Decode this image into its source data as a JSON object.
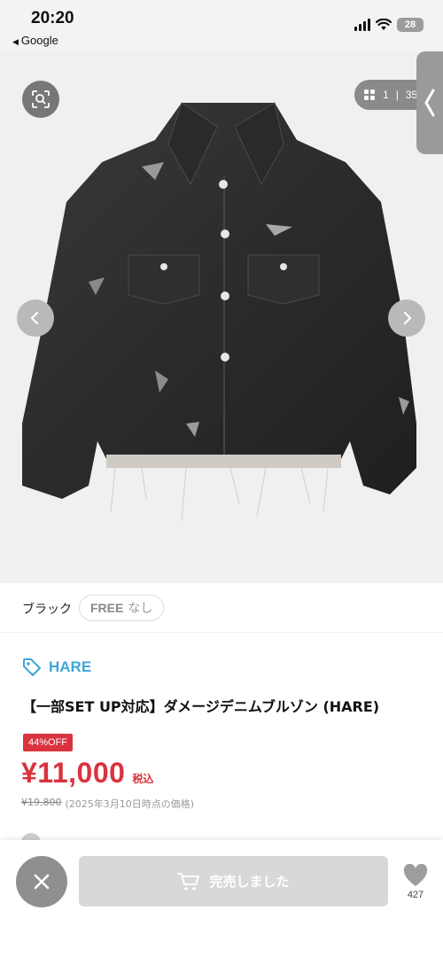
{
  "status_bar": {
    "time": "20:20",
    "back_app": "Google",
    "battery": "28"
  },
  "gallery": {
    "current": "1",
    "separator": "|",
    "total": "35",
    "icons": [
      "lens-icon",
      "grid-icon",
      "chevron-left-icon",
      "chevron-right-icon"
    ]
  },
  "variant": {
    "color_label": "ブラック",
    "size": "FREE",
    "stock": "なし"
  },
  "product": {
    "brand": "HARE",
    "title": "【一部SET UP対応】ダメージデニムブルゾン (HARE)",
    "discount_badge": "44%OFF",
    "price": "¥11,000",
    "tax_label": "税込",
    "original_price": "¥19,800",
    "price_note": "(2025年3月10日時点の価格)"
  },
  "bottom_bar": {
    "soldout_label": "完売しました",
    "favorite_count": "427"
  },
  "colors": {
    "accent_red": "#d9333f",
    "brand_blue": "#3fa6d6",
    "disabled_gray": "#d8d8d8"
  }
}
